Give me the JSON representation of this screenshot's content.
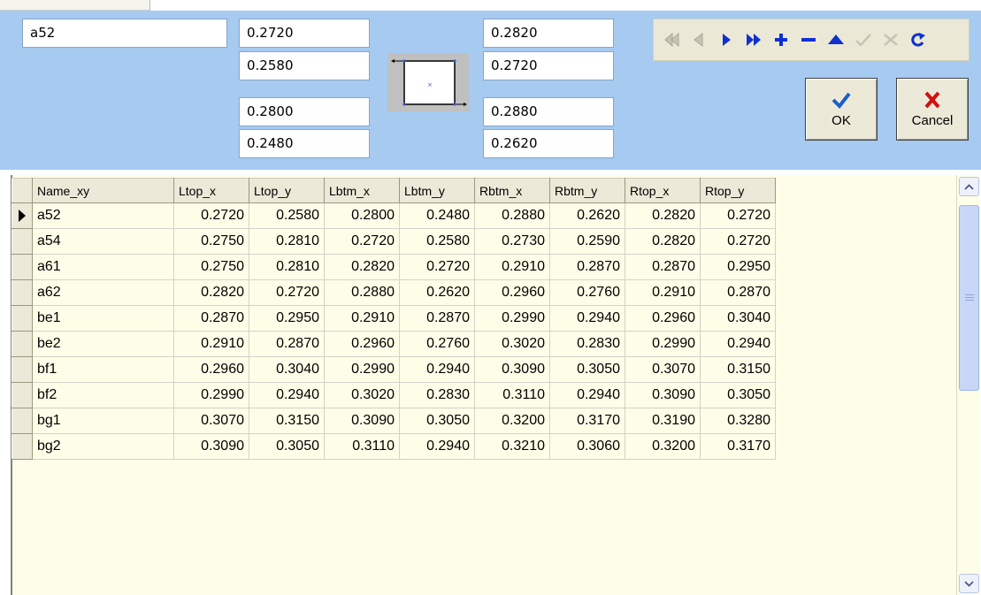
{
  "name_field": {
    "value": "a52"
  },
  "left_fields": [
    "0.2720",
    "0.2580",
    "0.2800",
    "0.2480"
  ],
  "right_fields": [
    "0.2820",
    "0.2720",
    "0.2880",
    "0.2620"
  ],
  "navigator": {
    "buttons": [
      {
        "icon": "first-record-icon",
        "enabled": false
      },
      {
        "icon": "prior-record-icon",
        "enabled": false
      },
      {
        "icon": "next-record-icon",
        "enabled": true
      },
      {
        "icon": "last-record-icon",
        "enabled": true
      },
      {
        "icon": "insert-record-icon",
        "enabled": true
      },
      {
        "icon": "delete-record-icon",
        "enabled": true
      },
      {
        "icon": "edit-record-icon",
        "enabled": true
      },
      {
        "icon": "post-edit-icon",
        "enabled": false
      },
      {
        "icon": "cancel-edit-icon",
        "enabled": false
      },
      {
        "icon": "refresh-icon",
        "enabled": true
      }
    ]
  },
  "buttons": {
    "ok": "OK",
    "cancel": "Cancel"
  },
  "colors": {
    "panel": "#a6caf0",
    "grid_bg": "#fefee8",
    "nav_blue": "#1030d0",
    "cancel_red": "#d01010",
    "ok_blue": "#1a5fc8"
  },
  "grid": {
    "columns": [
      "Name_xy",
      "Ltop_x",
      "Ltop_y",
      "Lbtm_x",
      "Lbtm_y",
      "Rbtm_x",
      "Rbtm_y",
      "Rtop_x",
      "Rtop_y"
    ],
    "rows": [
      [
        "a52",
        "0.2720",
        "0.2580",
        "0.2800",
        "0.2480",
        "0.2880",
        "0.2620",
        "0.2820",
        "0.2720"
      ],
      [
        "a54",
        "0.2750",
        "0.2810",
        "0.2720",
        "0.2580",
        "0.2730",
        "0.2590",
        "0.2820",
        "0.2720"
      ],
      [
        "a61",
        "0.2750",
        "0.2810",
        "0.2820",
        "0.2720",
        "0.2910",
        "0.2870",
        "0.2870",
        "0.2950"
      ],
      [
        "a62",
        "0.2820",
        "0.2720",
        "0.2880",
        "0.2620",
        "0.2960",
        "0.2760",
        "0.2910",
        "0.2870"
      ],
      [
        "be1",
        "0.2870",
        "0.2950",
        "0.2910",
        "0.2870",
        "0.2990",
        "0.2940",
        "0.2960",
        "0.3040"
      ],
      [
        "be2",
        "0.2910",
        "0.2870",
        "0.2960",
        "0.2760",
        "0.3020",
        "0.2830",
        "0.2990",
        "0.2940"
      ],
      [
        "bf1",
        "0.2960",
        "0.3040",
        "0.2990",
        "0.2940",
        "0.3090",
        "0.3050",
        "0.3070",
        "0.3150"
      ],
      [
        "bf2",
        "0.2990",
        "0.2940",
        "0.3020",
        "0.2830",
        "0.3110",
        "0.2940",
        "0.3090",
        "0.3050"
      ],
      [
        "bg1",
        "0.3070",
        "0.3150",
        "0.3090",
        "0.3050",
        "0.3200",
        "0.3170",
        "0.3190",
        "0.3280"
      ],
      [
        "bg2",
        "0.3090",
        "0.3050",
        "0.3110",
        "0.2940",
        "0.3210",
        "0.3060",
        "0.3200",
        "0.3170"
      ]
    ],
    "selected_row": 0
  }
}
